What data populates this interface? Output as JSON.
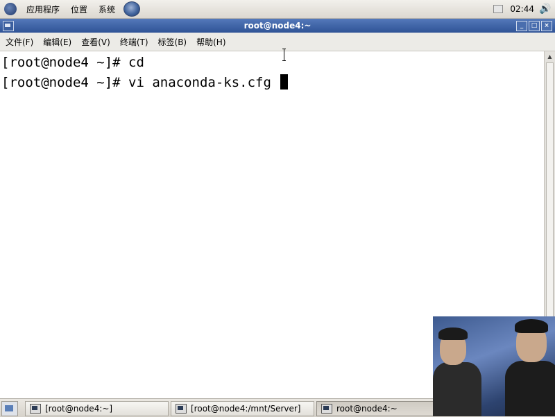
{
  "top_panel": {
    "menus": [
      "应用程序",
      "位置",
      "系统"
    ],
    "clock": "02:44"
  },
  "window": {
    "title": "root@node4:~",
    "menu": [
      "文件(F)",
      "编辑(E)",
      "查看(V)",
      "终端(T)",
      "标签(B)",
      "帮助(H)"
    ]
  },
  "terminal": {
    "lines": [
      "[root@node4 ~]# cd",
      "[root@node4 ~]# vi anaconda-ks.cfg "
    ]
  },
  "taskbar": {
    "tasks": [
      "[root@node4:~]",
      "[root@node4:/mnt/Server]",
      "root@node4:~"
    ]
  },
  "colors": {
    "titlebar": "#3a5fa3",
    "terminal_bg": "#ffffff",
    "terminal_fg": "#000000"
  }
}
